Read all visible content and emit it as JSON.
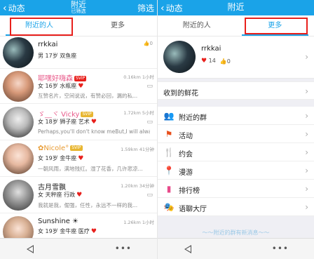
{
  "left": {
    "header": {
      "back_label": "动态",
      "title": "附近",
      "subtitle": "已筛选",
      "filter_label": "筛选"
    },
    "tabs": [
      {
        "label": "附近的人",
        "active": true
      },
      {
        "label": "更多",
        "active": false
      }
    ],
    "people": [
      {
        "name": "rrkkai",
        "meta": "男 17岁 双鱼座",
        "sign": "",
        "distance": "",
        "badge": "",
        "name_style": "normal",
        "side_icon": "0"
      },
      {
        "name": "耶嘿好嗨森",
        "meta": "女 16岁 水瓶座",
        "sign": "互赞名片，空间说说，有赞必回，漏的私...",
        "distance": "0.16km 1小时",
        "badge": "SVIP",
        "name_style": "pink",
        "side_icon": "▭"
      },
      {
        "name": "ゞ__ヾ Vicky",
        "meta": "女 18岁 狮子座 艺术",
        "sign": "Perhaps,you'll don't know meBut,I will always lo...",
        "distance": "1.72km 5小时",
        "badge": "SVIP",
        "name_style": "pink",
        "side_icon": "▭"
      },
      {
        "name": "Nicole",
        "meta": "女 19岁 金牛座",
        "sign": "一朝风雨，满地残红。湿了花香，几许悲凉...",
        "distance": "1.59km 41分钟",
        "badge": "SVIP",
        "name_style": "orange",
        "side_icon": ""
      },
      {
        "name": "古月雪飘",
        "meta": "女 天秤座 行政",
        "sign": "我就是我，倔强，任性，永远不一样的我...",
        "distance": "1.20km 34分钟",
        "badge": "",
        "name_style": "normal",
        "side_icon": "▭"
      },
      {
        "name": "Sunshine",
        "meta": "女 19岁 金牛座 医疗",
        "sign": "",
        "distance": "1.26km 1小时",
        "badge": "",
        "name_style": "normal",
        "side_icon": ""
      }
    ]
  },
  "right": {
    "header": {
      "back_label": "动态",
      "title": "附近"
    },
    "tabs": [
      {
        "label": "附近的人",
        "active": false
      },
      {
        "label": "更多",
        "active": true
      }
    ],
    "profile": {
      "name": "rrkkai",
      "hearts": "14",
      "likes": "0"
    },
    "flowers_label": "收到的鲜花",
    "menu": [
      {
        "label": "附近的群",
        "icon": "group-icon",
        "glyph": "👥",
        "color": "#1aa3e8"
      },
      {
        "label": "活动",
        "icon": "flag-icon",
        "glyph": "⚑",
        "color": "#e8501c"
      },
      {
        "label": "约会",
        "icon": "date-icon",
        "glyph": "🍴",
        "color": "#e8a030"
      },
      {
        "label": "漫游",
        "icon": "location-pin-icon",
        "glyph": "📍",
        "color": "#e84a8a"
      },
      {
        "label": "排行榜",
        "icon": "ranking-icon",
        "glyph": "▮",
        "color": "#e84a8a"
      },
      {
        "label": "语聊大厅",
        "icon": "mask-icon",
        "glyph": "🎭",
        "color": "#8a3ae8"
      }
    ],
    "more_hint": "～～附近的群有新消息～～"
  },
  "colors": {
    "header_bg": "#1aa3e8",
    "highlight_box": "#e8201c"
  }
}
